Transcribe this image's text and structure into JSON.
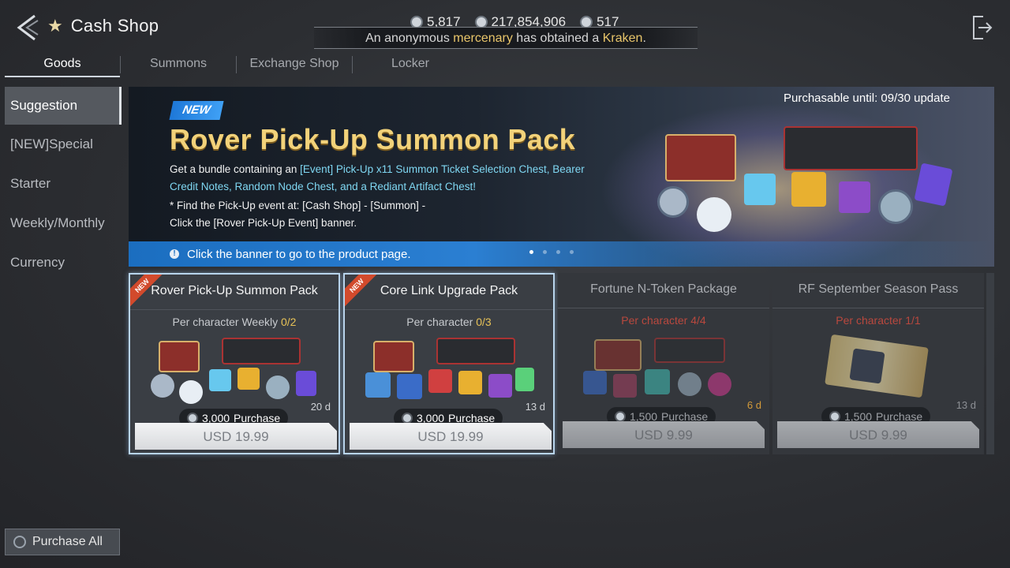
{
  "header": {
    "title": "Cash Shop",
    "currencies": [
      "5,817",
      "217,854,906",
      "517"
    ],
    "notice": {
      "pre": "An anonymous ",
      "who": "mercenary",
      "mid": " has obtained a ",
      "item": "Kraken",
      "post": "."
    }
  },
  "tabs": [
    "Goods",
    "Summons",
    "Exchange Shop",
    "Locker"
  ],
  "sidebar": {
    "items": [
      "Suggestion",
      "[NEW]Special",
      "Starter",
      "Weekly/Monthly",
      "Currency"
    ],
    "purchase_all": "Purchase All"
  },
  "banner": {
    "badge": "NEW",
    "title": "Rover Pick-Up Summon Pack",
    "until": "Purchasable until: 09/30 update",
    "desc_a": "Get a bundle containing an ",
    "desc_b": "[Event] Pick-Up x11 Summon Ticket Selection Chest, Bearer Credit Notes, Random Node Chest, and a Rediant Artifact Chest!",
    "find_1": "* Find the Pick-Up event at: [Cash Shop] - [Summon] -",
    "find_2": "Click the [Rover Pick-Up Event] banner.",
    "bar_text": "Click the banner to go to the product page."
  },
  "cards": [
    {
      "name": "Rover Pick-Up Summon Pack",
      "badge": "NEW",
      "limit_label": "Per character Weekly ",
      "limit": "0/2",
      "days": "20 d",
      "gems": "3,000",
      "purchase": "Purchase",
      "price": "USD 19.99"
    },
    {
      "name": "Core Link Upgrade Pack",
      "badge": "NEW",
      "limit_label": "Per character ",
      "limit": "0/3",
      "days": "13 d",
      "gems": "3,000",
      "purchase": "Purchase",
      "price": "USD 19.99"
    },
    {
      "name": "Fortune N-Token Package",
      "badge": "",
      "limit_label": "Per character ",
      "limit": "4/4",
      "days": "6 d",
      "gems": "1,500",
      "purchase": "Purchase",
      "price": "USD 9.99"
    },
    {
      "name": "RF September Season Pass",
      "badge": "",
      "limit_label": "Per character ",
      "limit": "1/1",
      "days": "13 d",
      "gems": "1,500",
      "purchase": "Purchase",
      "price": "USD 9.99"
    }
  ],
  "colors": {
    "accent_gold": "#f2d27a",
    "info_blue": "#2b7fd2",
    "limit_red": "#b9483e",
    "limit_yellow": "#e7c257"
  }
}
